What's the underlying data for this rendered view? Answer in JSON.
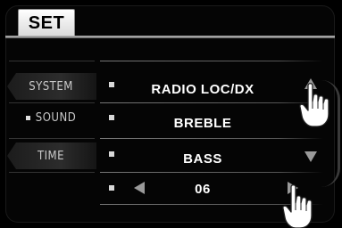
{
  "tab": {
    "label": "SET"
  },
  "categories": [
    {
      "label": "SYSTEM",
      "selected": false
    },
    {
      "label": "SOUND",
      "selected": true
    },
    {
      "label": "TIME",
      "selected": false
    }
  ],
  "settings": [
    {
      "label": "RADIO LOC/DX"
    },
    {
      "label": "BREBLE"
    },
    {
      "label": "BASS"
    },
    {
      "label": "06"
    }
  ],
  "icons": {
    "scroll_up": "triangle-up-icon",
    "scroll_down": "triangle-down-icon",
    "decrease": "triangle-left-icon",
    "increase": "triangle-right-icon",
    "touch": "pointing-hand-icon"
  }
}
